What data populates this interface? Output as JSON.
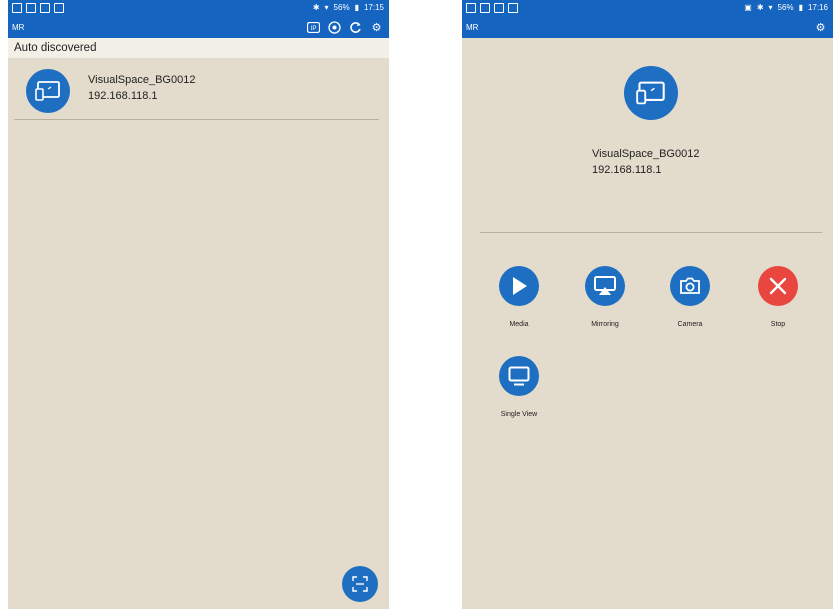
{
  "left_screen": {
    "status_bar": {
      "time": "17:15",
      "battery": "56%"
    },
    "app_bar": {
      "title": "MR"
    },
    "section_title": "Auto discovered",
    "device": {
      "name": "VisualSpace_BG0012",
      "ip": "192.168.118.1"
    }
  },
  "right_screen": {
    "status_bar": {
      "time": "17:16",
      "battery": "56%"
    },
    "app_bar": {
      "title": "MR"
    },
    "device": {
      "name": "VisualSpace_BG0012",
      "ip": "192.168.118.1"
    },
    "actions": [
      {
        "label": "Media",
        "icon": "play-icon",
        "color": "#1e6fc2"
      },
      {
        "label": "Mirroring",
        "icon": "mirroring-icon",
        "color": "#1e6fc2"
      },
      {
        "label": "Camera",
        "icon": "camera-icon",
        "color": "#1e6fc2"
      },
      {
        "label": "Stop",
        "icon": "close-icon",
        "color": "#e8463f"
      },
      {
        "label": "Single View",
        "icon": "monitor-icon",
        "color": "#1e6fc2"
      }
    ]
  },
  "colors": {
    "app_bar": "#1565c0",
    "background": "#e3dccc",
    "accent": "#1e6fc2",
    "stop": "#e8463f"
  }
}
